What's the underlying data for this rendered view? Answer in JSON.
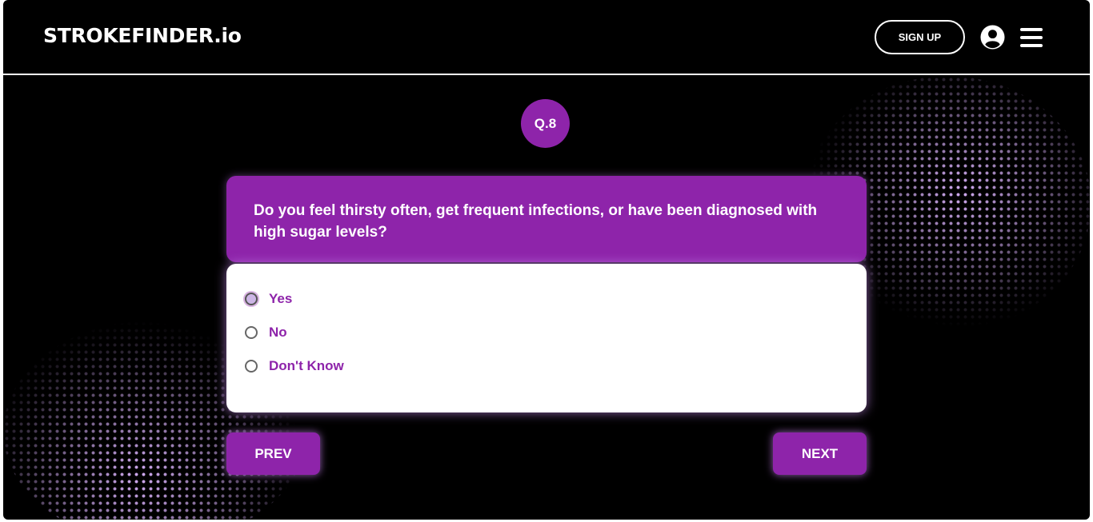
{
  "header": {
    "brand": "STROKEFINDER.io",
    "signup_label": "SIGN UP",
    "user_icon": "user-circle-icon",
    "menu_icon": "hamburger-menu-icon"
  },
  "question": {
    "number_label": "Q.8",
    "text": "Do you feel thirsty often, get frequent infections, or have been diagnosed with high sugar levels?",
    "options": [
      {
        "label": "Yes",
        "selected": true
      },
      {
        "label": "No",
        "selected": false
      },
      {
        "label": "Don't Know",
        "selected": false
      }
    ]
  },
  "nav": {
    "prev_label": "PREV",
    "next_label": "NEXT"
  },
  "colors": {
    "accent": "#8e24aa",
    "background": "#000000",
    "card": "#ffffff"
  }
}
